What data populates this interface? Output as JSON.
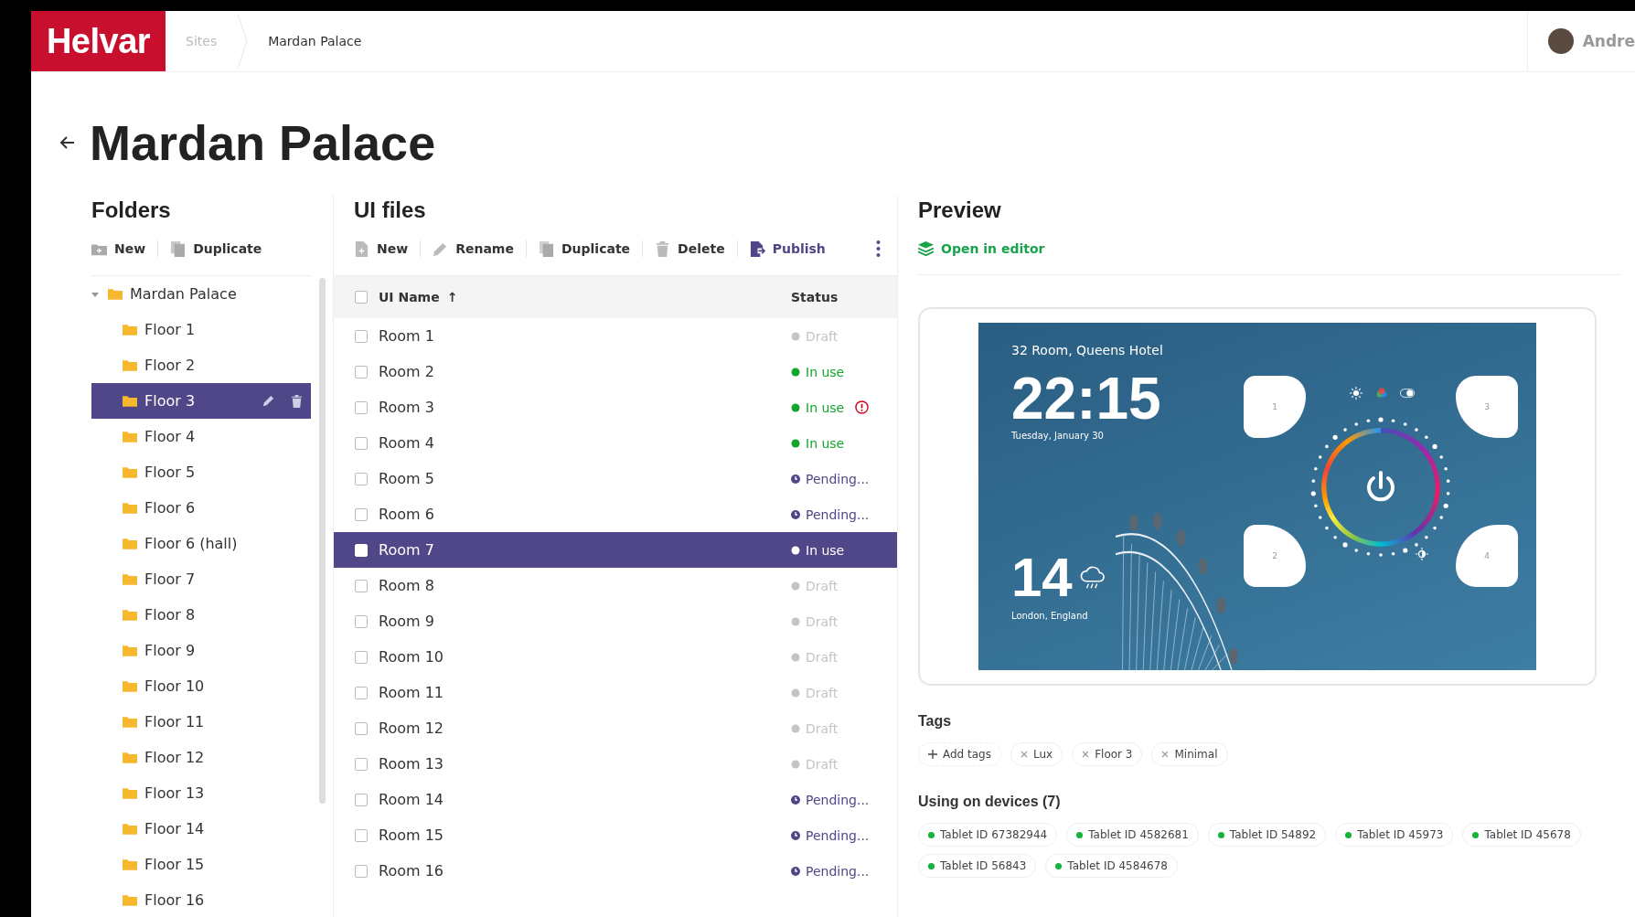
{
  "logo": "Helvar",
  "breadcrumbs": [
    {
      "label": "Sites",
      "current": false
    },
    {
      "label": "Mardan Palace",
      "current": true
    }
  ],
  "user": {
    "name": "Andre"
  },
  "page_title": "Mardan Palace",
  "folders": {
    "title": "Folders",
    "actions": [
      {
        "label": "New",
        "kind": "new"
      },
      {
        "label": "Duplicate",
        "kind": "duplicate"
      }
    ],
    "tree": [
      {
        "label": "Mardan Palace",
        "expanded": true,
        "selected": false,
        "children": [
          {
            "label": "Floor 1",
            "selected": false
          },
          {
            "label": "Floor 2",
            "selected": false
          },
          {
            "label": "Floor 3",
            "selected": true
          },
          {
            "label": "Floor 4",
            "selected": false
          },
          {
            "label": "Floor 5",
            "selected": false
          },
          {
            "label": "Floor 6",
            "selected": false
          },
          {
            "label": "Floor 6 (hall)",
            "selected": false
          },
          {
            "label": "Floor 7",
            "selected": false
          },
          {
            "label": "Floor 8",
            "selected": false
          },
          {
            "label": "Floor 9",
            "selected": false
          },
          {
            "label": "Floor 10",
            "selected": false
          },
          {
            "label": "Floor 11",
            "selected": false
          },
          {
            "label": "Floor 12",
            "selected": false
          },
          {
            "label": "Floor 13",
            "selected": false
          },
          {
            "label": "Floor 14",
            "selected": false
          },
          {
            "label": "Floor 15",
            "selected": false
          },
          {
            "label": "Floor 16",
            "selected": false
          }
        ]
      }
    ]
  },
  "ui_files": {
    "title": "UI files",
    "actions": [
      {
        "label": "New",
        "kind": "new"
      },
      {
        "label": "Rename",
        "kind": "rename"
      },
      {
        "label": "Duplicate",
        "kind": "duplicate"
      },
      {
        "label": "Delete",
        "kind": "delete"
      },
      {
        "label": "Publish",
        "kind": "publish"
      }
    ],
    "select_all_checked": false,
    "columns": [
      {
        "label": "UI Name",
        "sort_arrow": "↑"
      },
      {
        "label": "Status"
      }
    ],
    "rows": [
      {
        "name": "Room 1",
        "status": "Draft",
        "kind": "draft",
        "warning": false,
        "selected": false
      },
      {
        "name": "Room 2",
        "status": "In use",
        "kind": "inuse",
        "warning": false,
        "selected": false
      },
      {
        "name": "Room 3",
        "status": "In use",
        "kind": "inuse",
        "warning": true,
        "selected": false
      },
      {
        "name": "Room 4",
        "status": "In use",
        "kind": "inuse",
        "warning": false,
        "selected": false
      },
      {
        "name": "Room 5",
        "status": "Pending...",
        "kind": "pending",
        "warning": false,
        "selected": false
      },
      {
        "name": "Room 6",
        "status": "Pending...",
        "kind": "pending",
        "warning": false,
        "selected": false
      },
      {
        "name": "Room 7",
        "status": "In use",
        "kind": "inuse",
        "warning": false,
        "selected": true
      },
      {
        "name": "Room 8",
        "status": "Draft",
        "kind": "draft",
        "warning": false,
        "selected": false
      },
      {
        "name": "Room 9",
        "status": "Draft",
        "kind": "draft",
        "warning": false,
        "selected": false
      },
      {
        "name": "Room 10",
        "status": "Draft",
        "kind": "draft",
        "warning": false,
        "selected": false
      },
      {
        "name": "Room 11",
        "status": "Draft",
        "kind": "draft",
        "warning": false,
        "selected": false
      },
      {
        "name": "Room 12",
        "status": "Draft",
        "kind": "draft",
        "warning": false,
        "selected": false
      },
      {
        "name": "Room 13",
        "status": "Draft",
        "kind": "draft",
        "warning": false,
        "selected": false
      },
      {
        "name": "Room 14",
        "status": "Pending...",
        "kind": "pending",
        "warning": false,
        "selected": false
      },
      {
        "name": "Room 15",
        "status": "Pending...",
        "kind": "pending",
        "warning": false,
        "selected": false
      },
      {
        "name": "Room 16",
        "status": "Pending...",
        "kind": "pending",
        "warning": false,
        "selected": false
      }
    ]
  },
  "preview": {
    "title": "Preview",
    "open_link": "Open in editor",
    "screen": {
      "location": "32 Room, Queens Hotel",
      "time": "22:15",
      "date": "Tuesday, January 30",
      "temperature": "14",
      "city": "London, England",
      "buttons": [
        "1",
        "3",
        "2",
        "4"
      ]
    },
    "tags_title": "Tags",
    "add_tags": "Add tags",
    "tags": [
      "Lux",
      "Floor 3",
      "Minimal"
    ],
    "devices_title": "Using on devices (7)",
    "devices": [
      "Tablet ID 67382944",
      "Tablet ID 4582681",
      "Tablet ID 54892",
      "Tablet ID 45973",
      "Tablet ID 45678",
      "Tablet ID 56843",
      "Tablet ID 4584678"
    ]
  }
}
